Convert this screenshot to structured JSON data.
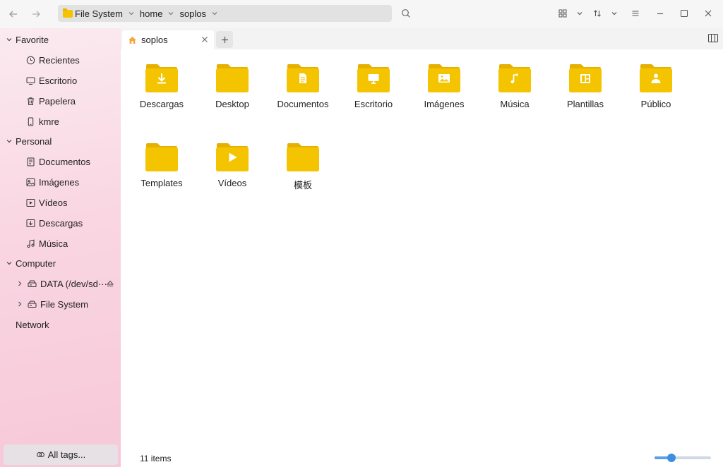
{
  "toolbar": {
    "back_icon": "arrow-left-icon",
    "forward_icon": "arrow-right-icon",
    "breadcrumbs": [
      {
        "label": "File System"
      },
      {
        "label": "home"
      },
      {
        "label": "soplos"
      }
    ],
    "search_icon": "search-icon",
    "view_icon": "grid-view-icon",
    "sort_icon": "sort-icon",
    "menu_icon": "hamburger-menu-icon"
  },
  "sidebar": {
    "groups": [
      {
        "label": "Favorite",
        "items": [
          {
            "label": "Recientes",
            "icon": "clock-icon"
          },
          {
            "label": "Escritorio",
            "icon": "desktop-icon"
          },
          {
            "label": "Papelera",
            "icon": "trash-icon"
          },
          {
            "label": "kmre",
            "icon": "phone-icon"
          }
        ]
      },
      {
        "label": "Personal",
        "items": [
          {
            "label": "Documentos",
            "icon": "document-icon"
          },
          {
            "label": "Imágenes",
            "icon": "image-icon"
          },
          {
            "label": "Vídeos",
            "icon": "video-icon"
          },
          {
            "label": "Descargas",
            "icon": "download-icon"
          },
          {
            "label": "Música",
            "icon": "music-icon"
          }
        ]
      },
      {
        "label": "Computer",
        "items": [
          {
            "label": "DATA (/dev/sd···",
            "icon": "drive-icon"
          },
          {
            "label": "File System",
            "icon": "drive-icon"
          }
        ]
      },
      {
        "label": "Network",
        "items": []
      }
    ],
    "all_tags": "All tags..."
  },
  "tabs": [
    {
      "label": "soplos"
    }
  ],
  "files": [
    {
      "name": "Descargas",
      "icon": "folder-download-icon"
    },
    {
      "name": "Desktop",
      "icon": "folder-icon"
    },
    {
      "name": "Documentos",
      "icon": "folder-document-icon"
    },
    {
      "name": "Escritorio",
      "icon": "folder-desktop-icon"
    },
    {
      "name": "Imágenes",
      "icon": "folder-image-icon"
    },
    {
      "name": "Música",
      "icon": "folder-music-icon"
    },
    {
      "name": "Plantillas",
      "icon": "folder-template-icon"
    },
    {
      "name": "Público",
      "icon": "folder-public-icon"
    },
    {
      "name": "Templates",
      "icon": "folder-icon"
    },
    {
      "name": "Vídeos",
      "icon": "folder-video-icon"
    },
    {
      "name": "模板",
      "icon": "folder-icon"
    }
  ],
  "status": {
    "item_count": "11 items",
    "zoom_fraction": 0.3
  },
  "colors": {
    "folder": "#f5c400",
    "folder_dark": "#e6b000",
    "accent": "#3c8ee0"
  }
}
